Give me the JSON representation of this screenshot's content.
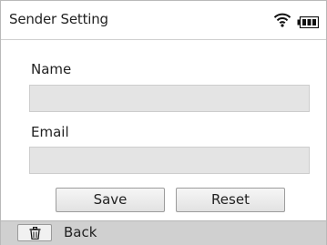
{
  "header": {
    "title": "Sender Setting",
    "wifi_icon": "wifi-icon",
    "battery_icon": "battery-icon"
  },
  "form": {
    "name_label": "Name",
    "name_value": "",
    "email_label": "Email",
    "email_value": ""
  },
  "buttons": {
    "save_label": "Save",
    "reset_label": "Reset"
  },
  "footer": {
    "trash_icon": "trash-icon",
    "back_label": "Back"
  }
}
